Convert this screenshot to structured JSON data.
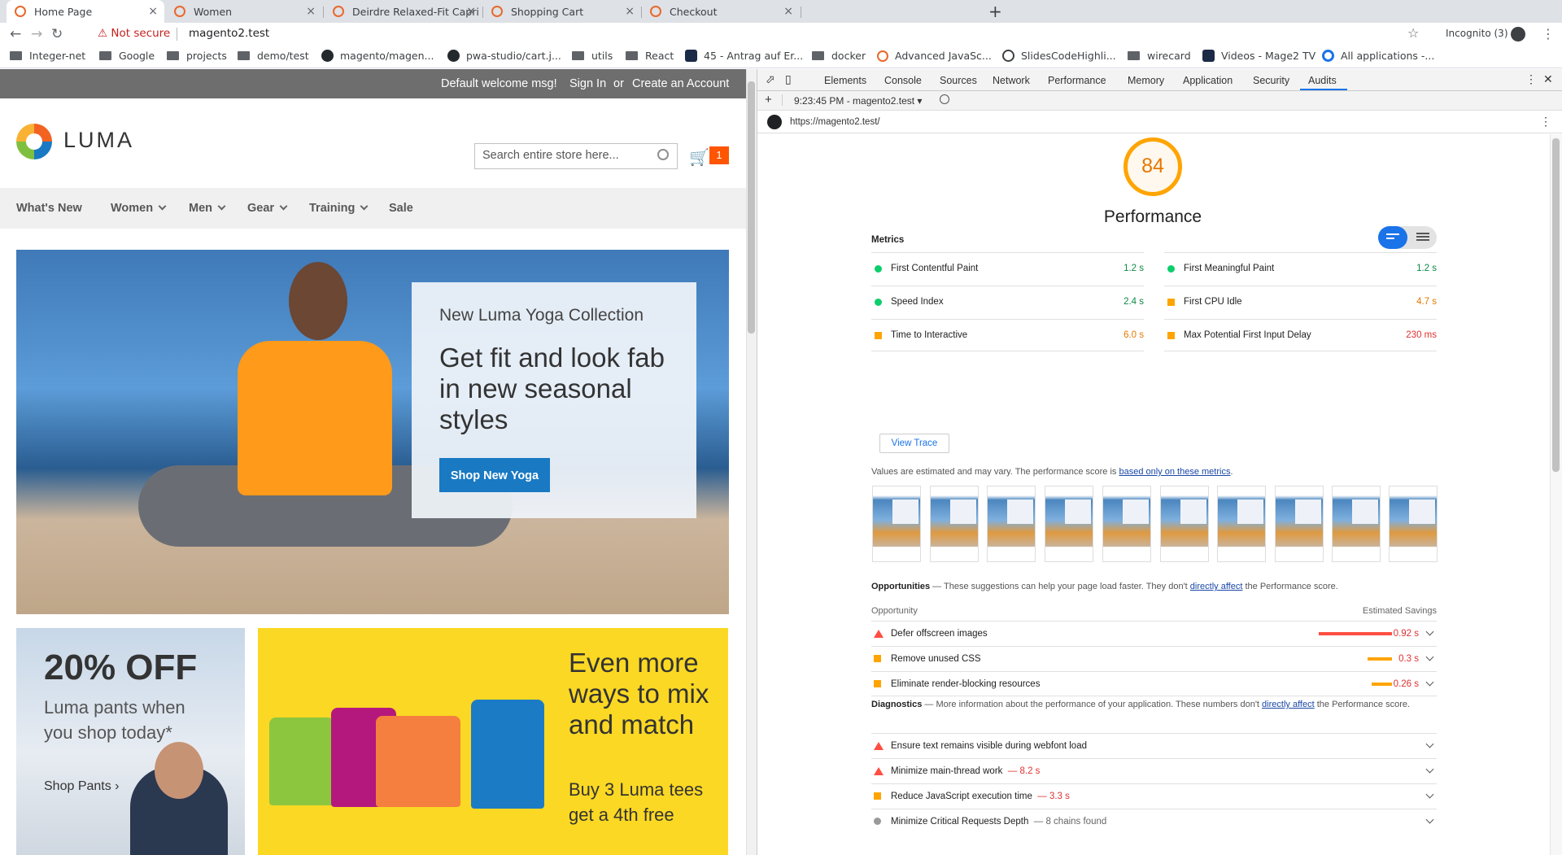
{
  "browser": {
    "tabs": [
      {
        "title": "Home Page",
        "active": true
      },
      {
        "title": "Women",
        "active": false
      },
      {
        "title": "Deirdre Relaxed-Fit Capri",
        "active": false
      },
      {
        "title": "Shopping Cart",
        "active": false
      },
      {
        "title": "Checkout",
        "active": false
      }
    ],
    "tab_close_glyph": "×",
    "new_tab_glyph": "+",
    "security_label": "Not secure",
    "url": "magento2.test",
    "incognito_label": "Incognito (3)",
    "bookmarks": [
      {
        "label": "Integer-net",
        "icon": "folder-icon"
      },
      {
        "label": "Google",
        "icon": "folder-icon"
      },
      {
        "label": "projects",
        "icon": "folder-icon"
      },
      {
        "label": "demo/test",
        "icon": "folder-icon"
      },
      {
        "label": "magento/magen...",
        "icon": "github-icon"
      },
      {
        "label": "pwa-studio/cart.j...",
        "icon": "github-icon"
      },
      {
        "label": "utils",
        "icon": "folder-icon"
      },
      {
        "label": "React",
        "icon": "folder-icon"
      },
      {
        "label": "45 - Antrag auf Er...",
        "icon": "site-icon"
      },
      {
        "label": "docker",
        "icon": "folder-icon"
      },
      {
        "label": "Advanced JavaSc...",
        "icon": "magento-icon"
      },
      {
        "label": "SlidesCodeHighli...",
        "icon": "globe-icon"
      },
      {
        "label": "wirecard",
        "icon": "folder-icon"
      },
      {
        "label": "Videos - Mage2 TV",
        "icon": "mage2tv-icon"
      },
      {
        "label": "All applications -...",
        "icon": "apps-icon"
      }
    ]
  },
  "store": {
    "panel": {
      "welcome": "Default welcome msg!",
      "sign_in": "Sign In",
      "or": "or",
      "create_account": "Create an Account"
    },
    "logo_text": "LUMA",
    "search_placeholder": "Search entire store here...",
    "cart_count": "1",
    "nav": [
      "What's New",
      "Women",
      "Men",
      "Gear",
      "Training",
      "Sale"
    ],
    "hero": {
      "subtitle": "New Luma Yoga Collection",
      "title": "Get fit and look fab in new seasonal styles",
      "button": "Shop New Yoga"
    },
    "promo_pants": {
      "headline": "20% OFF",
      "text": "Luma pants when you shop today*",
      "link": "Shop Pants"
    },
    "promo_tees": {
      "headline": "Even more ways to mix and match",
      "text": "Buy 3 Luma tees get a 4th free"
    }
  },
  "devtools": {
    "tabs": [
      "Elements",
      "Console",
      "Sources",
      "Network",
      "Performance",
      "Memory",
      "Application",
      "Security",
      "Audits"
    ],
    "selected_tab": "Audits",
    "run_label": "9:23:45 PM - magento2.test",
    "report_url": "https://magento2.test/",
    "score": "84",
    "category": "Performance",
    "metrics_title": "Metrics",
    "metrics": [
      {
        "label": "First Contentful Paint",
        "value": "1.2 s",
        "rating": "pass"
      },
      {
        "label": "First Meaningful Paint",
        "value": "1.2 s",
        "rating": "pass"
      },
      {
        "label": "Speed Index",
        "value": "2.4 s",
        "rating": "pass"
      },
      {
        "label": "First CPU Idle",
        "value": "4.7 s",
        "rating": "average"
      },
      {
        "label": "Time to Interactive",
        "value": "6.0 s",
        "rating": "average"
      },
      {
        "label": "Max Potential First Input Delay",
        "value": "230 ms",
        "rating": "average"
      }
    ],
    "view_trace": "View Trace",
    "estimate_note": "Values are estimated and may vary. The performance score is",
    "estimate_link": "based only on these metrics",
    "estimate_end": ".",
    "opportunities": {
      "title": "Opportunities",
      "desc": " — These suggestions can help your page load faster. They don't",
      "link": "directly affect",
      "desc_end": "the Performance score.",
      "col_left": "Opportunity",
      "col_right": "Estimated Savings",
      "items": [
        {
          "label": "Defer offscreen images",
          "savings": "0.92 s",
          "rating": "fail",
          "fraction": 1.0
        },
        {
          "label": "Remove unused CSS",
          "savings": "0.3 s",
          "rating": "average",
          "fraction": 0.33
        },
        {
          "label": "Eliminate render-blocking resources",
          "savings": "0.26 s",
          "rating": "average",
          "fraction": 0.28
        }
      ]
    },
    "diagnostics": {
      "title": "Diagnostics",
      "desc": " — More information about the performance of your application. These numbers don't",
      "link": "directly affect",
      "desc_end": "the Performance score.",
      "items": [
        {
          "label": "Ensure text remains visible during webfont load",
          "detail": "",
          "rating": "fail"
        },
        {
          "label": "Minimize main-thread work",
          "detail": "— 8.2 s",
          "rating": "fail"
        },
        {
          "label": "Reduce JavaScript execution time",
          "detail": "— 3.3 s",
          "rating": "average"
        },
        {
          "label": "Minimize Critical Requests Depth",
          "detail": "— 8 chains found",
          "rating": "info"
        }
      ]
    }
  },
  "colors": {
    "pass": "#0cce6b",
    "average": "#ffa400",
    "fail": "#ff4e42",
    "luma_blue": "#1979c3",
    "cart_badge": "#ff5501",
    "promo_yellow": "#fbd823"
  }
}
